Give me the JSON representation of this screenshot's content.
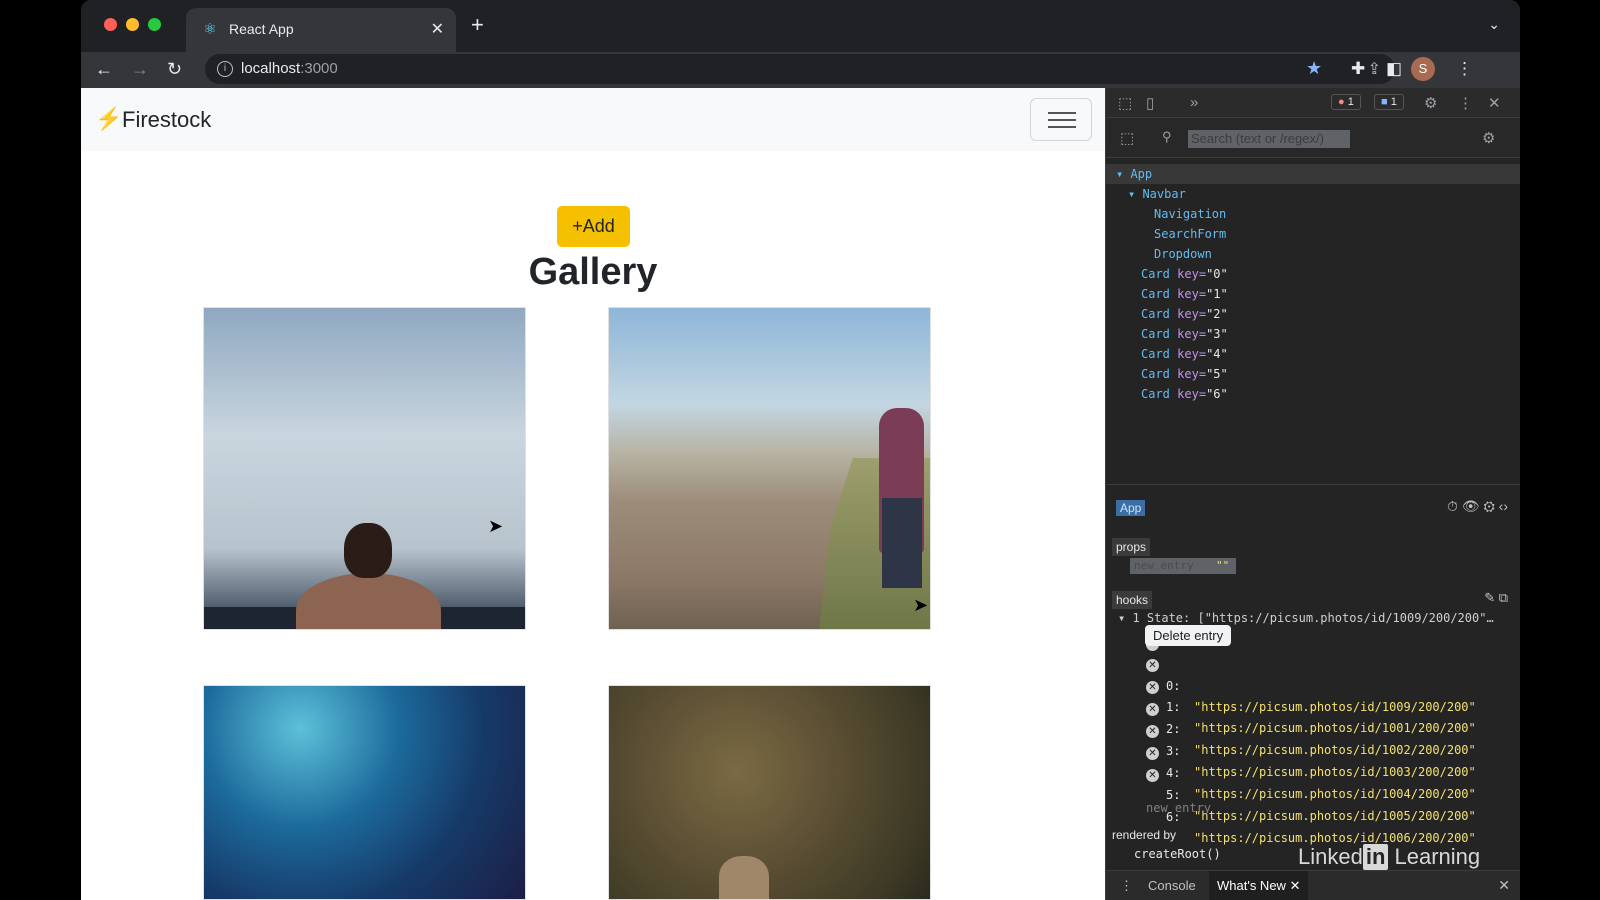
{
  "browser": {
    "tab_title": "React App",
    "url_host": "localhost",
    "url_port": ":3000"
  },
  "app": {
    "brand": "Firestock",
    "add_button": "+Add",
    "heading": "Gallery"
  },
  "devtools": {
    "search_placeholder": "Search (text or /regex/)",
    "error_count": "1",
    "message_count": "1",
    "tree": [
      {
        "label": "App",
        "indent": 1
      },
      {
        "label": "Navbar",
        "indent": 2
      },
      {
        "label": "Navigation",
        "indent": 3
      },
      {
        "label": "SearchForm",
        "indent": 3
      },
      {
        "label": "Dropdown",
        "indent": 3
      }
    ],
    "cards": [
      {
        "tag": "Card",
        "attr": "key",
        "value": "\"0\""
      },
      {
        "tag": "Card",
        "attr": "key",
        "value": "\"1\""
      },
      {
        "tag": "Card",
        "attr": "key",
        "value": "\"2\""
      },
      {
        "tag": "Card",
        "attr": "key",
        "value": "\"3\""
      },
      {
        "tag": "Card",
        "attr": "key",
        "value": "\"4\""
      },
      {
        "tag": "Card",
        "attr": "key",
        "value": "\"5\""
      },
      {
        "tag": "Card",
        "attr": "key",
        "value": "\"6\""
      }
    ],
    "selected_component": "App",
    "props_label": "props",
    "props_new_entry": "new entry",
    "props_new_entry_value": "\"\"",
    "hooks_label": "hooks",
    "state_line": "1 State: [\"https://picsum.photos/id/1009/200/200\"…",
    "tooltip": "Delete entry",
    "hooks": [
      {
        "index": "0:",
        "value": "\"https://picsum.photos/id/1009/200/200\""
      },
      {
        "index": "1:",
        "value": "\"https://picsum.photos/id/1001/200/200\""
      },
      {
        "index": "2:",
        "value": "\"https://picsum.photos/id/1002/200/200\""
      },
      {
        "index": "3:",
        "value": "\"https://picsum.photos/id/1003/200/200\""
      },
      {
        "index": "4:",
        "value": "\"https://picsum.photos/id/1004/200/200\""
      },
      {
        "index": "5:",
        "value": "\"https://picsum.photos/id/1005/200/200\""
      },
      {
        "index": "6:",
        "value": "\"https://picsum.photos/id/1006/200/200\""
      }
    ],
    "new_entry": "new entry",
    "rendered_by": "rendered by",
    "create_root": "createRoot()",
    "watermark_pre": "Linked",
    "watermark_in": "in",
    "watermark_post": " Learning",
    "drawer_console": "Console",
    "drawer_whats_new": "What's New"
  }
}
